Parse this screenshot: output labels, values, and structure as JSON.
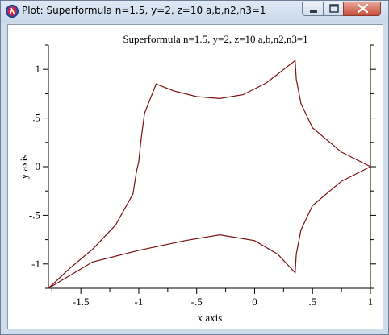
{
  "window": {
    "title": "Plot: Superformula n=1.5, y=2, z=10 a,b,n2,n3=1",
    "app_icon": "lambda-icon",
    "controls": [
      "minimize-icon",
      "maximize-icon",
      "close-icon"
    ]
  },
  "chart_data": {
    "type": "line",
    "title": "Superformula n=1.5, y=2, z=10 a,b,n2,n3=1",
    "xlabel": "x axis",
    "ylabel": "y axis",
    "xlim": [
      -1.78,
      1.0
    ],
    "ylim": [
      -1.25,
      1.25
    ],
    "x_ticks": [
      -1.5,
      -1,
      -0.5,
      0,
      0.5,
      1
    ],
    "x_tick_labels": [
      "-1.5",
      "-1",
      "-.5",
      "0",
      ".5",
      "1"
    ],
    "y_ticks": [
      1,
      0.5,
      0,
      -0.5,
      -1
    ],
    "y_tick_labels": [
      "1",
      ".5",
      "0",
      "-.5",
      "-1"
    ],
    "grid": false,
    "curve_color": "#7a1010",
    "series": [
      {
        "x": [
          1.0,
          0.75,
          0.5,
          0.4,
          0.36,
          0.35,
          0.1,
          -0.1,
          -0.3,
          -0.5,
          -0.7,
          -0.85,
          -0.95,
          -0.98,
          -1.0,
          -1.02,
          -1.05,
          -1.2,
          -1.4,
          -1.6,
          -1.78,
          -1.4,
          -1.0,
          -0.6,
          -0.3,
          0.0,
          0.2,
          0.35,
          0.36,
          0.4,
          0.5,
          0.75,
          1.0
        ],
        "y": [
          0.0,
          0.15,
          0.4,
          0.65,
          0.9,
          1.09,
          0.86,
          0.74,
          0.7,
          0.72,
          0.78,
          0.85,
          0.55,
          0.28,
          0.05,
          -0.05,
          -0.28,
          -0.6,
          -0.85,
          -1.05,
          -1.25,
          -0.98,
          -0.86,
          -0.76,
          -0.7,
          -0.76,
          -0.9,
          -1.09,
          -0.9,
          -0.65,
          -0.4,
          -0.15,
          0.0
        ]
      }
    ]
  }
}
